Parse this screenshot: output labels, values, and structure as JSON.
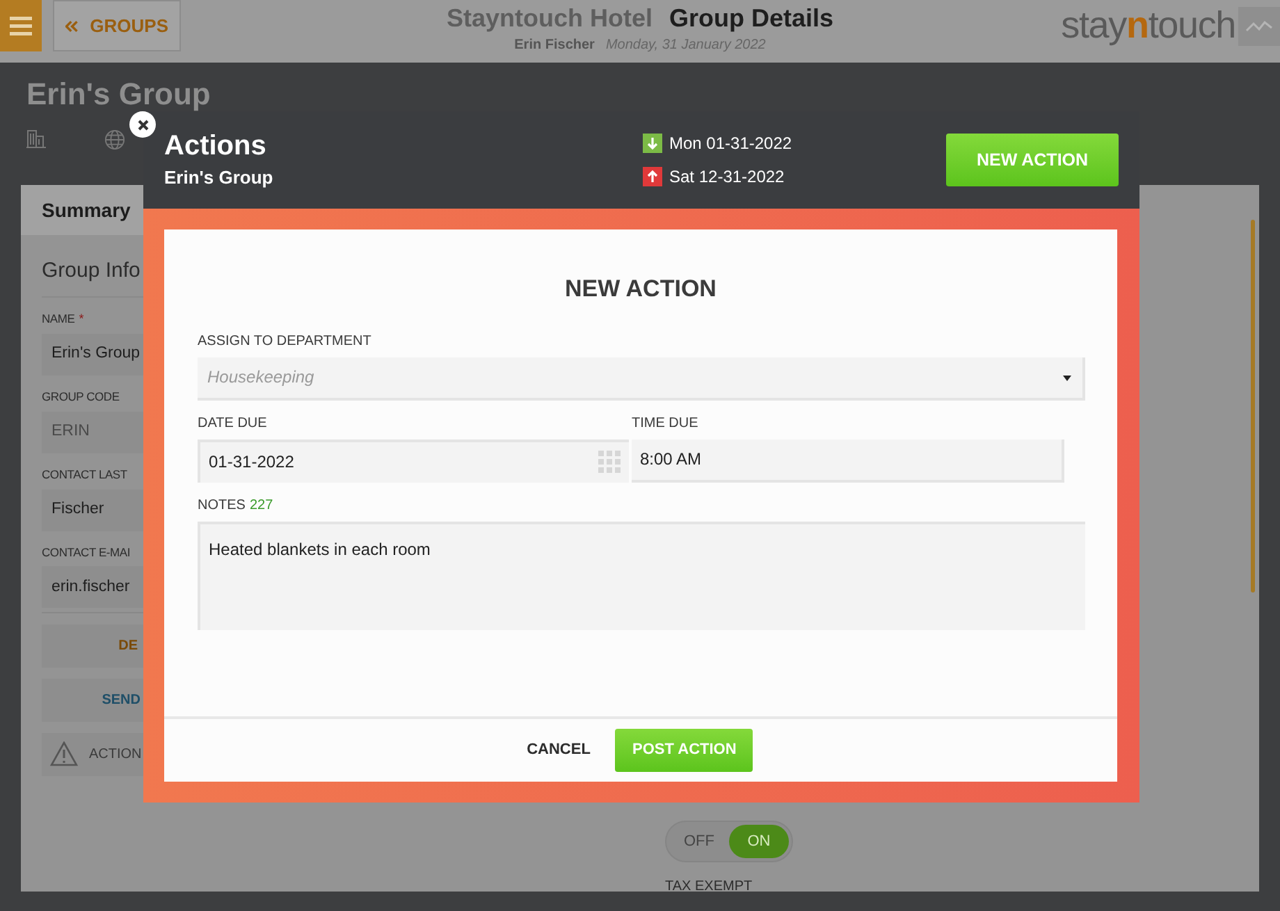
{
  "header": {
    "groups_button": "GROUPS",
    "hotel": "Stayntouch Hotel",
    "page_title": "Group Details",
    "user": "Erin Fischer",
    "date": "Monday, 31 January 2022",
    "logo": {
      "before": "stay",
      "accent": "n",
      "after": "touch"
    }
  },
  "group_title": "Erin's Group",
  "tabs": [
    {
      "label": "Summary",
      "selected": true
    }
  ],
  "group_info": {
    "heading": "Group Info",
    "fields": [
      {
        "label": "NAME",
        "required_mark": "*",
        "value": "Erin's Group",
        "disabled": false
      },
      {
        "label": "GROUP CODE",
        "value": "ERIN",
        "disabled": true
      },
      {
        "label": "CONTACT LAST",
        "value": "Fischer",
        "disabled": false
      },
      {
        "label": "CONTACT E-MAI",
        "value": "erin.fischer",
        "disabled": false
      }
    ],
    "buttons": [
      {
        "label": "DE",
        "kind": "primary"
      },
      {
        "label": "SEND",
        "kind": "secondary"
      },
      {
        "label": "ACTION",
        "kind": "alert"
      }
    ]
  },
  "toggle": {
    "off": "OFF",
    "on": "ON",
    "value_on": true
  },
  "tax_exempt": "TAX EXEMPT",
  "modal": {
    "title": "Actions",
    "subtitle": "Erin's Group",
    "arrival": "Mon 01-31-2022",
    "departure": "Sat 12-31-2022",
    "new_action": "NEW ACTION",
    "form": {
      "heading": "NEW ACTION",
      "department": {
        "label": "ASSIGN TO DEPARTMENT",
        "placeholder": "Housekeeping"
      },
      "date": {
        "label": "DATE DUE",
        "value": "01-31-2022"
      },
      "time": {
        "label": "TIME DUE",
        "value": "8:00 AM"
      },
      "notes": {
        "label": "NOTES",
        "count": "227",
        "value": "Heated blankets in each room"
      },
      "cancel": "CANCEL",
      "post": "POST ACTION"
    }
  }
}
